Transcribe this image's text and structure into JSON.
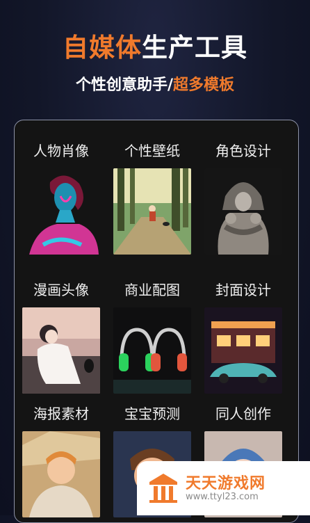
{
  "hero": {
    "title_accent": "自媒体",
    "title_rest": "生产工具",
    "subtitle_plain": "个性创意助手/",
    "subtitle_accent": "超多模板"
  },
  "templates": [
    {
      "label": "人物肖像",
      "image": "neon-portrait-woman"
    },
    {
      "label": "个性壁纸",
      "image": "forest-path-wallpaper"
    },
    {
      "label": "角色设计",
      "image": "armored-character"
    },
    {
      "label": "漫画头像",
      "image": "anime-girl-beach"
    },
    {
      "label": "商业配图",
      "image": "headphones-product"
    },
    {
      "label": "封面设计",
      "image": "neon-diner-car"
    },
    {
      "label": "海报素材",
      "image": "cartoon-girl-food"
    },
    {
      "label": "宝宝预测",
      "image": "cartoon-boy"
    },
    {
      "label": "同人创作",
      "image": "fan-art-character"
    }
  ],
  "watermark": {
    "name": "天天游戏网",
    "url": "www.ttyl23.com"
  },
  "colors": {
    "accent": "#f07a2c",
    "background": "#121628",
    "panel": "#141414"
  }
}
